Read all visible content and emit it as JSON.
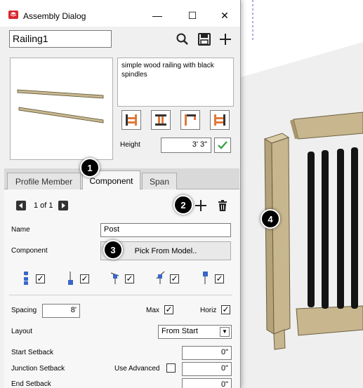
{
  "window": {
    "title": "Assembly Dialog",
    "minimize": "—",
    "maximize": "☐",
    "close": "✕"
  },
  "header": {
    "assembly_name": "Railing1"
  },
  "description": "simple wood railing with black spindles",
  "height": {
    "label": "Height",
    "value": "3' 3\""
  },
  "tabs": [
    {
      "label": "Profile Member"
    },
    {
      "label": "Component"
    },
    {
      "label": "Span"
    }
  ],
  "component": {
    "page_indicator": "1 of 1",
    "name_label": "Name",
    "name_value": "Post",
    "component_label": "Component",
    "pick_button": "Pick From Model..",
    "snap_checks": [
      true,
      true,
      true,
      true,
      true
    ]
  },
  "spacing": {
    "spacing_label": "Spacing",
    "spacing_value": "8'",
    "max_label": "Max",
    "max_checked": true,
    "horiz_label": "Horiz",
    "horiz_checked": true,
    "layout_label": "Layout",
    "layout_value": "From Start",
    "start_setback_label": "Start Setback",
    "start_setback_value": "0\"",
    "junction_setback_label": "Junction Setback",
    "use_advanced_label": "Use Advanced",
    "use_advanced_checked": false,
    "junction_setback_value": "0\"",
    "end_setback_label": "End Setback",
    "end_setback_value": "0\""
  },
  "callouts": [
    "1",
    "2",
    "3",
    "4"
  ],
  "colors": {
    "accent_orange": "#e0793a",
    "ok_green": "#2e9e3e",
    "wood": "#c7b68e",
    "spindle": "#141414"
  }
}
